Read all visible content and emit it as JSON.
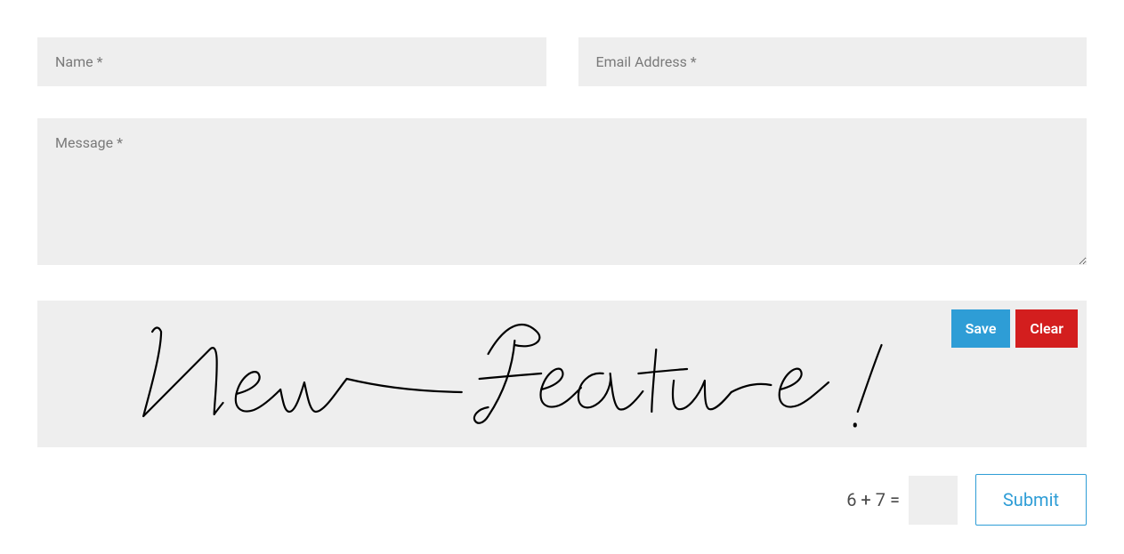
{
  "form": {
    "name": {
      "placeholder": "Name *",
      "value": ""
    },
    "email": {
      "placeholder": "Email Address *",
      "value": ""
    },
    "message": {
      "placeholder": "Message *",
      "value": ""
    }
  },
  "signature": {
    "drawn_text": "New Feature!",
    "save_label": "Save",
    "clear_label": "Clear"
  },
  "captcha": {
    "question": "6 + 7 =",
    "value": ""
  },
  "submit": {
    "label": "Submit"
  },
  "colors": {
    "input_bg": "#eeeeee",
    "save_bg": "#2e9dd6",
    "clear_bg": "#d31e1e",
    "submit_border": "#2e9dd6",
    "submit_text": "#2e9dd6"
  }
}
